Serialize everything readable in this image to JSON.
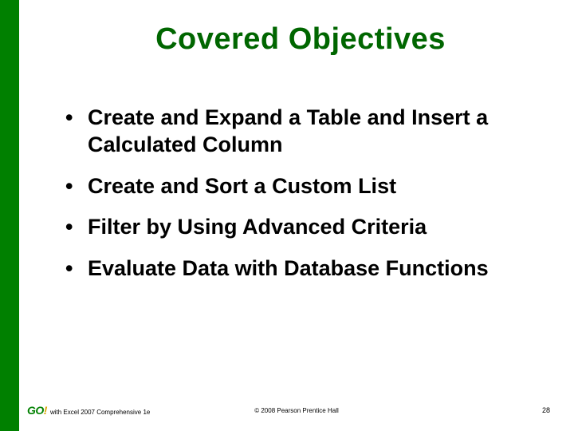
{
  "title": "Covered Objectives",
  "bullets": [
    "Create and Expand a Table and Insert a Calculated Column",
    "Create and Sort a Custom List",
    "Filter by Using Advanced Criteria",
    "Evaluate Data with Database Functions"
  ],
  "footer": {
    "logo_text": "GO",
    "logo_bang": "!",
    "left": "with Excel 2007 Comprehensive 1e",
    "center": "© 2008 Pearson Prentice Hall",
    "page": "28"
  },
  "colors": {
    "accent": "#008000",
    "title": "#006600"
  }
}
